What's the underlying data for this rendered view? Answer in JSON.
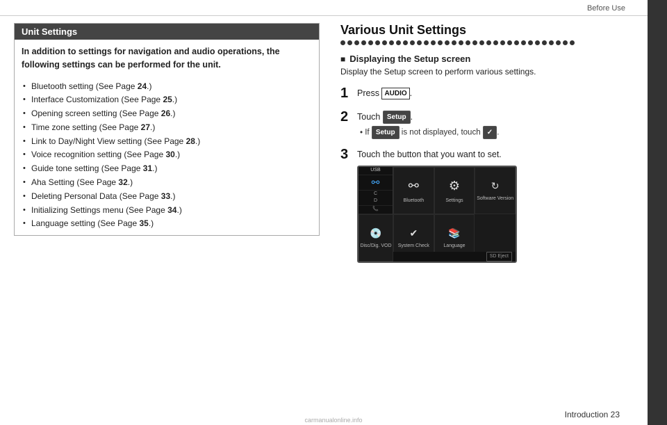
{
  "header": {
    "label": "Before Use"
  },
  "left": {
    "box_title": "Unit Settings",
    "intro": "In addition to settings for navigation and audio operations, the following settings can be performed for the unit.",
    "bullets": [
      {
        "text": "Bluetooth setting (See Page ",
        "bold": "24",
        "suffix": ".)"
      },
      {
        "text": "Interface Customization (See Page ",
        "bold": "25",
        "suffix": ".)"
      },
      {
        "text": "Opening screen setting (See Page ",
        "bold": "26",
        "suffix": ".)"
      },
      {
        "text": "Time zone setting (See Page ",
        "bold": "27",
        "suffix": ".)"
      },
      {
        "text": "Link to Day/Night View setting (See Page ",
        "bold": "28",
        "suffix": ".)"
      },
      {
        "text": "Voice recognition setting (See Page ",
        "bold": "30",
        "suffix": ".)"
      },
      {
        "text": "Guide tone setting (See Page ",
        "bold": "31",
        "suffix": ".)"
      },
      {
        "text": "Aha Setting (See Page ",
        "bold": "32",
        "suffix": ".)"
      },
      {
        "text": "Deleting Personal Data (See Page ",
        "bold": "33",
        "suffix": ".)"
      },
      {
        "text": "Initializing Settings menu (See Page ",
        "bold": "34",
        "suffix": ".)"
      },
      {
        "text": "Language setting (See Page ",
        "bold": "35",
        "suffix": ".)"
      }
    ]
  },
  "right": {
    "title": "Various Unit Settings",
    "dots_count": 34,
    "section_heading": "Displaying the Setup screen",
    "section_subtext": "Display the Setup screen to perform various settings.",
    "steps": [
      {
        "number": "1",
        "text": "Press ",
        "badge": "AUDIO",
        "badge_type": "audio",
        "suffix": "."
      },
      {
        "number": "2",
        "text": "Touch ",
        "badge": "Setup",
        "badge_type": "setup",
        "suffix": ".",
        "sub": "If  Setup  is not displayed, touch  ✓ ."
      },
      {
        "number": "3",
        "text": "Touch the button that you want to set."
      }
    ],
    "setup_cells": [
      {
        "icon": "bluetooth",
        "label": "Bluetooth",
        "col": 1,
        "row": 1
      },
      {
        "icon": "settings",
        "label": "Settings",
        "col": 2,
        "row": 1
      },
      {
        "icon": "software",
        "label": "Software Version",
        "col": 3,
        "row": 1
      },
      {
        "icon": "disc",
        "label": "Disc/Dig. VOD",
        "col": 1,
        "row": 2
      },
      {
        "icon": "system",
        "label": "System Check",
        "col": 2,
        "row": 2
      },
      {
        "icon": "language",
        "label": "Language",
        "col": 3,
        "row": 2
      }
    ]
  },
  "footer": {
    "label": "Introduction   23"
  },
  "watermark": {
    "text": "carmanualonline.info"
  }
}
